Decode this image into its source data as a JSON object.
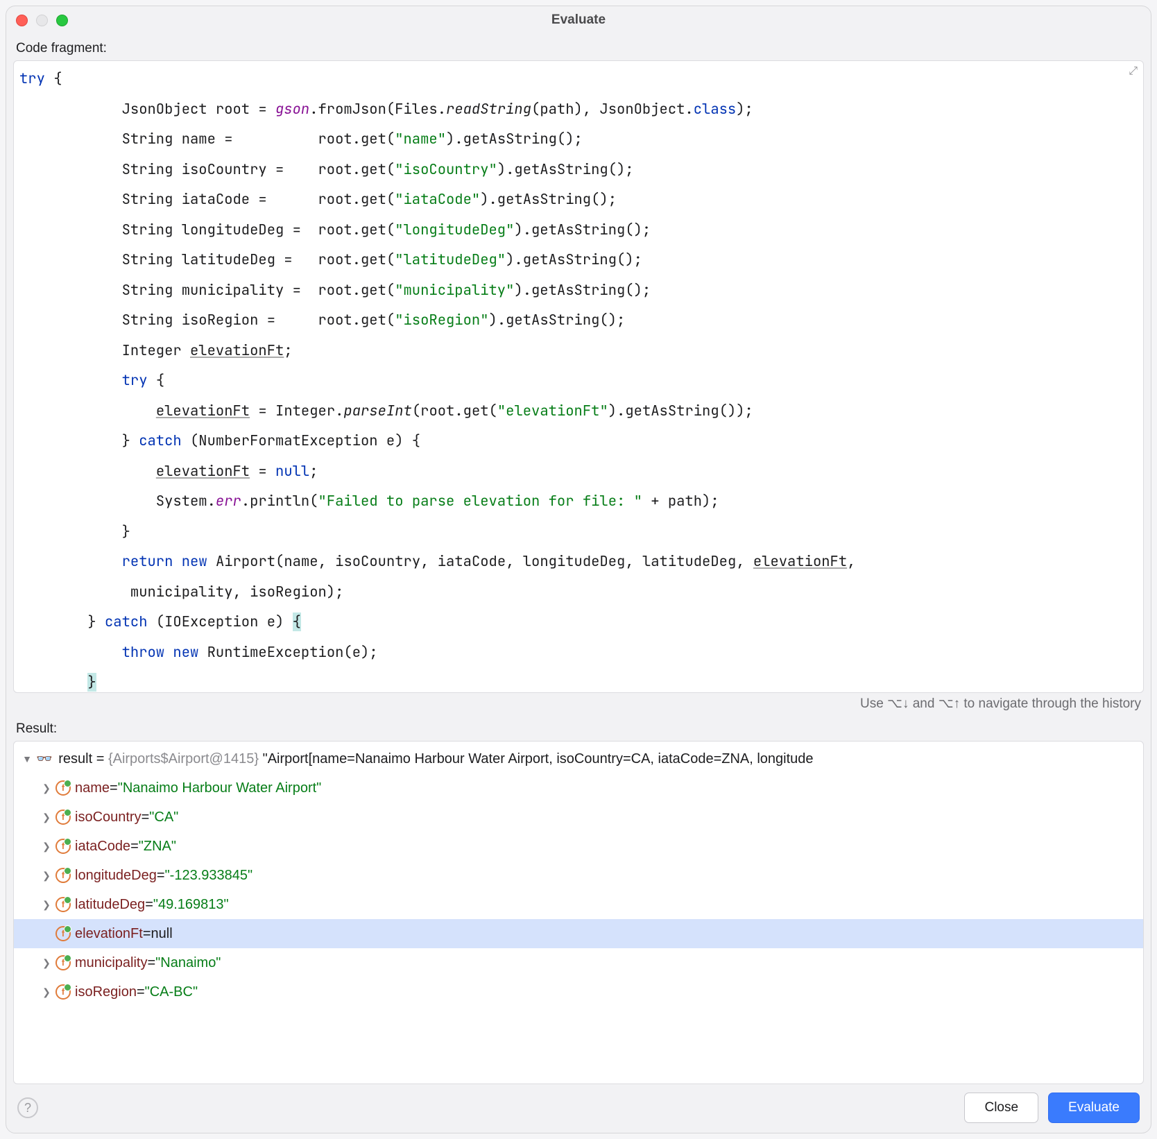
{
  "title": "Evaluate",
  "labels": {
    "code_fragment": "Code fragment:",
    "result": "Result:",
    "hint": "Use ⌥↓ and ⌥↑ to navigate through the history"
  },
  "code": {
    "keywords": {
      "try": "try",
      "catch": "catch",
      "new": "new",
      "return": "return",
      "class": "class",
      "null": "null",
      "throw": "throw"
    },
    "fields": {
      "gson": "gson",
      "err": "err"
    },
    "methods": {
      "readString": "readString",
      "parseInt": "parseInt"
    },
    "strings": {
      "name": "\"name\"",
      "isoCountry": "\"isoCountry\"",
      "iataCode": "\"iataCode\"",
      "longitudeDeg": "\"longitudeDeg\"",
      "latitudeDeg": "\"latitudeDeg\"",
      "municipality": "\"municipality\"",
      "isoRegion": "\"isoRegion\"",
      "elevationFt": "\"elevationFt\"",
      "fail": "\"Failed to parse elevation for file: \""
    },
    "text": {
      "l1_open": " {",
      "l2": "            JsonObject root = ",
      "l2b": ".fromJson(Files.",
      "l2c": "(path), JsonObject.",
      "l2d": ");",
      "l3a": "            String name =          root.get(",
      "l3b": ").getAsString();",
      "l4a": "            String isoCountry =    root.get(",
      "l5a": "            String iataCode =      root.get(",
      "l6a": "            String longitudeDeg =  root.get(",
      "l7a": "            String latitudeDeg =   root.get(",
      "l8a": "            String municipality =  root.get(",
      "l9a": "            String isoRegion =     root.get(",
      "l10": "            Integer ",
      "l10b": "elevationFt",
      "l10c": ";",
      "l11a": "            ",
      "l11b": " {",
      "l12a": "                ",
      "l12b": "elevationFt",
      "l12c": " = Integer.",
      "l12d": "(root.get(",
      "l12e": ").getAsString());",
      "l13a": "            } ",
      "l13b": " (NumberFormatException e) {",
      "l14a": "                ",
      "l14b": "elevationFt",
      "l14c": " = ",
      "l14d": ";",
      "l15a": "                System.",
      "l15b": ".println(",
      "l15c": " + path);",
      "l16": "            }",
      "l17a": "            ",
      "l17b": " ",
      "l17c": " Airport(name, isoCountry, iataCode, longitudeDeg, latitudeDeg, ",
      "l17d": "elevationFt",
      "l17e": ",",
      "l18": "             municipality, isoRegion);",
      "l19a": "        } ",
      "l19b": " (IOException e) ",
      "l19c": "{",
      "l20a": "            ",
      "l20b": " ",
      "l20c": " RuntimeException(e);",
      "l21a": "        ",
      "l21b": "}"
    }
  },
  "result_root": {
    "name": "result",
    "type": "{Airports$Airport@1415}",
    "value": "\"Airport[name=Nanaimo Harbour Water Airport, isoCountry=CA, iataCode=ZNA, longitude"
  },
  "result_fields": [
    {
      "name": "name",
      "value": "\"Nanaimo Harbour Water Airport\"",
      "null": false,
      "arrow": true
    },
    {
      "name": "isoCountry",
      "value": "\"CA\"",
      "null": false,
      "arrow": true
    },
    {
      "name": "iataCode",
      "value": "\"ZNA\"",
      "null": false,
      "arrow": true
    },
    {
      "name": "longitudeDeg",
      "value": "\"-123.933845\"",
      "null": false,
      "arrow": true
    },
    {
      "name": "latitudeDeg",
      "value": "\"49.169813\"",
      "null": false,
      "arrow": true
    },
    {
      "name": "elevationFt",
      "value": "null",
      "null": true,
      "arrow": false,
      "selected": true
    },
    {
      "name": "municipality",
      "value": "\"Nanaimo\"",
      "null": false,
      "arrow": true
    },
    {
      "name": "isoRegion",
      "value": "\"CA-BC\"",
      "null": false,
      "arrow": true
    }
  ],
  "buttons": {
    "close": "Close",
    "evaluate": "Evaluate"
  }
}
